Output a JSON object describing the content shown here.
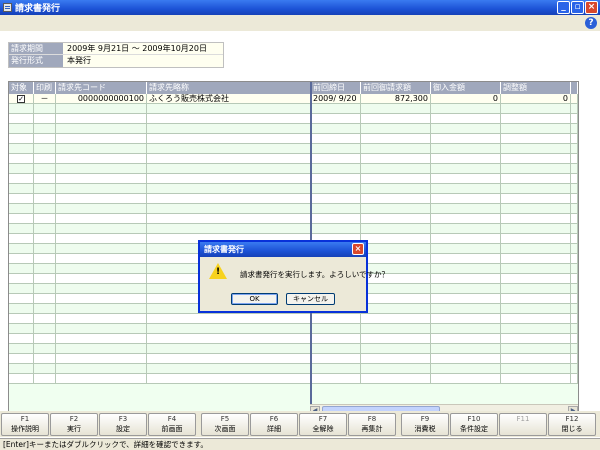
{
  "window": {
    "title": "請求書発行"
  },
  "info": {
    "period_label": "請求期間",
    "period_value": "2009年 9月21日 ～ 2009年10月20日",
    "type_label": "発行形式",
    "type_value": "本発行"
  },
  "grid": {
    "headers": [
      "対象",
      "印刷",
      "請求先コード",
      "請求先略称",
      "前回締日",
      "前回御請求額",
      "御入金額",
      "調整額"
    ],
    "rows": [
      {
        "target": "✓",
        "print": "－",
        "code": "0000000000100",
        "name": "ふくろう販売株式会社",
        "prev_date": "2009/ 9/20",
        "prev_bill": "872,300",
        "paid": "0",
        "adjust": "0"
      }
    ]
  },
  "dialog": {
    "title": "請求書発行",
    "message": "請求書発行を実行します。よろしいですか？",
    "ok": "OK",
    "cancel": "キャンセル"
  },
  "fkeys": [
    {
      "key": "F1",
      "label": "操作説明"
    },
    {
      "key": "F2",
      "label": "実行"
    },
    {
      "key": "F3",
      "label": "設定"
    },
    {
      "key": "F4",
      "label": "前画面"
    },
    {
      "key": "F5",
      "label": "次画面"
    },
    {
      "key": "F6",
      "label": "詳細"
    },
    {
      "key": "F7",
      "label": "全解除"
    },
    {
      "key": "F8",
      "label": "再集計"
    },
    {
      "key": "F9",
      "label": "消費税"
    },
    {
      "key": "F10",
      "label": "条件設定"
    },
    {
      "key": "F11",
      "label": ""
    },
    {
      "key": "F12",
      "label": "閉じる"
    }
  ],
  "status": {
    "text": "[Enter]キーまたはダブルクリックで、詳細を確認できます。"
  },
  "colors": {
    "titlebar": "#1c52d6",
    "header": "#a0a8bc",
    "row_alt": "#eefcee",
    "warn": "#f7d21e"
  }
}
